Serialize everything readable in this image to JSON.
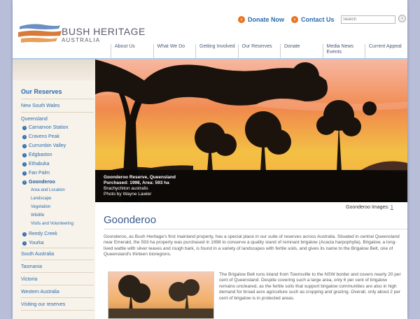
{
  "brand": {
    "name": "BUSH HERITAGE",
    "sub": "AUSTRALIA"
  },
  "utility": {
    "donate": "Donate Now",
    "contact": "Contact Us",
    "search_placeholder": "Search"
  },
  "nav": [
    "About Us",
    "What We Do",
    "Getting Involved",
    "Our Reserves",
    "Donate",
    "Media News Events",
    "Current Appeal"
  ],
  "sidebar": {
    "title": "Our Reserves",
    "items": [
      "New South Wales",
      "Queensland",
      "Carnarvon Station",
      "Cravens Peak",
      "Currumbin Valley",
      "Edgbaston",
      "Ethabuka",
      "Fan Palm",
      "Goonderoo",
      "Area and Location",
      "Landscape",
      "Vegetation",
      "Wildlife",
      "Visits and Volunteering",
      "Reedy Creek",
      "Yourka",
      "South Australia",
      "Tasmania",
      "Victoria",
      "Western Australia",
      "Visiting our reserves"
    ]
  },
  "caption": {
    "line1": "Goonderoo Reserve, Queensland",
    "line2": "Purchased: 1998, Area: 593 ha",
    "line3": "Brachychiton australis",
    "line4": "Photo by Wayne Lawler"
  },
  "images": {
    "label": "Goonderoo Images:",
    "link": "1"
  },
  "page": {
    "title": "Goonderoo",
    "intro": "Goonderoo, as Bush Heritage's first mainland property, has a special place in our suite of reserves across Australia. Situated in central Queensland near Emerald, the 593 ha property was purchased in 1998 to conserve a quality stand of remnant brigalow (Acacia harpophylla). Brigalow, a long-lived wattle with silver leaves and rough bark, is found in a variety of landscapes with fertile soils, and gives its name to the Brigalow Belt, one of Queensland's thirteen bioregions.",
    "body2": "The Brigalow Belt runs inland from Townsville to the NSW border and covers nearly 20 per cent of Queensland. Despite covering such a large area, only 6 per cent of brigalow remains uncleared, as the fertile soils that support brigalow communities are also in high demand for broad acre agriculture such as cropping and grazing. Overall, only about 2 per cent of brigalow is in protected areas."
  },
  "colors": {
    "accent": "#e8731e",
    "link": "#2a6cae",
    "sidebar_bg": "#f7f2ea"
  },
  "icons": {
    "util": "arrow-circle-icon",
    "search": "search-go-icon",
    "sub": "arrow-bullet-icon"
  }
}
